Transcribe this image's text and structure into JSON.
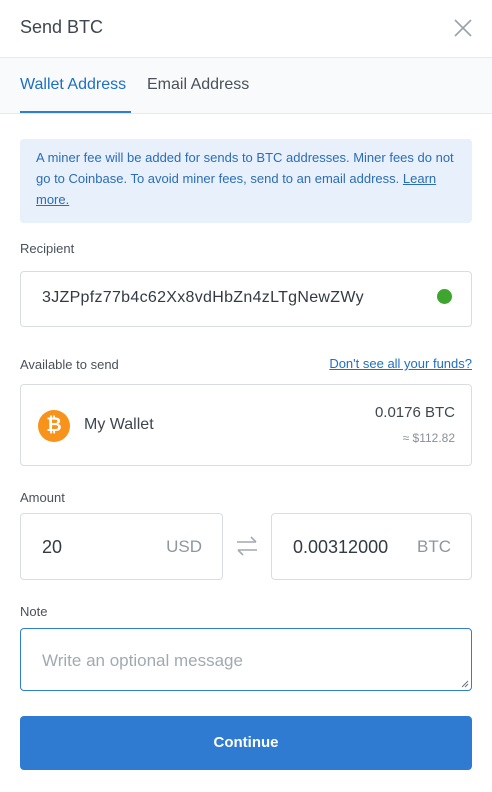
{
  "header": {
    "title": "Send BTC"
  },
  "tabs": [
    {
      "label": "Wallet Address",
      "active": true
    },
    {
      "label": "Email Address",
      "active": false
    }
  ],
  "notice": {
    "text": "A miner fee will be added for sends to BTC addresses. Miner fees do not go to Coinbase. To avoid miner fees, send to an email address. ",
    "link": "Learn more."
  },
  "recipient": {
    "label": "Recipient",
    "value": "3JZPpfz77b4c62Xx8vdHbZn4zLTgNewZWy"
  },
  "available": {
    "label": "Available to send",
    "link": "Don't see all your funds?",
    "wallet_name": "My Wallet",
    "amount": "0.0176 BTC",
    "fiat": "≈ $112.82",
    "icon": "bitcoin-icon"
  },
  "amount": {
    "label": "Amount",
    "fiat_value": "20",
    "fiat_currency": "USD",
    "crypto_value": "0.00312000",
    "crypto_currency": "BTC"
  },
  "note": {
    "label": "Note",
    "placeholder": "Write an optional message"
  },
  "actions": {
    "continue": "Continue"
  },
  "colors": {
    "accent": "#2f7bd2",
    "bitcoin": "#f7931a",
    "success": "#3ea52f",
    "notice_bg": "#e7f0fb"
  }
}
